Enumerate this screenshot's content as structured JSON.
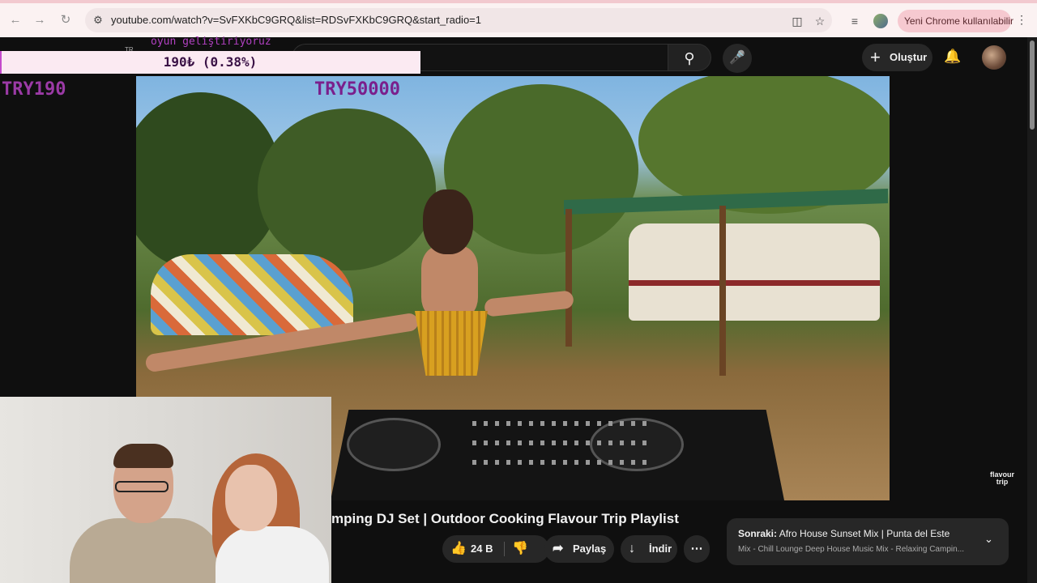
{
  "browser": {
    "url": "youtube.com/watch?v=SvFXKbC9GRQ&list=RDSvFXKbC9GRQ&start_radio=1",
    "new_chrome_label": "Yeni Chrome kullanılabilir",
    "icons": [
      "back-icon",
      "forward-icon",
      "reload-icon",
      "site-info-icon",
      "install-icon",
      "bookmark-star-icon",
      "reading-list-icon",
      "profile-icon",
      "menu-kebab-icon"
    ]
  },
  "youtube": {
    "create_label": "Oluştur",
    "icons": [
      "search-icon",
      "mic-icon",
      "plus-icon",
      "bell-icon",
      "avatar"
    ]
  },
  "overlay": {
    "top_text": "oyun geliştiriyoruz",
    "tr_tag": "TR",
    "donation_text": "190₺ (0.38%)",
    "donation_progress_percent": 0.38,
    "left_amount": "TRY190",
    "goal_amount": "TRY50000",
    "progress_color": "#c44acb"
  },
  "video": {
    "title": "mping DJ Set | Outdoor Cooking Flavour Trip Playlist",
    "watermark_line1": "flavour",
    "watermark_line2": "trip"
  },
  "actions": {
    "like_count": "24 B",
    "share_label": "Paylaş",
    "download_label": "İndir"
  },
  "up_next": {
    "prefix": "Sonraki:",
    "title": "Afro House Sunset Mix | Punta del Este",
    "subtitle": "Mix - Chill Lounge Deep House Music Mix - Relaxing Campin..."
  }
}
